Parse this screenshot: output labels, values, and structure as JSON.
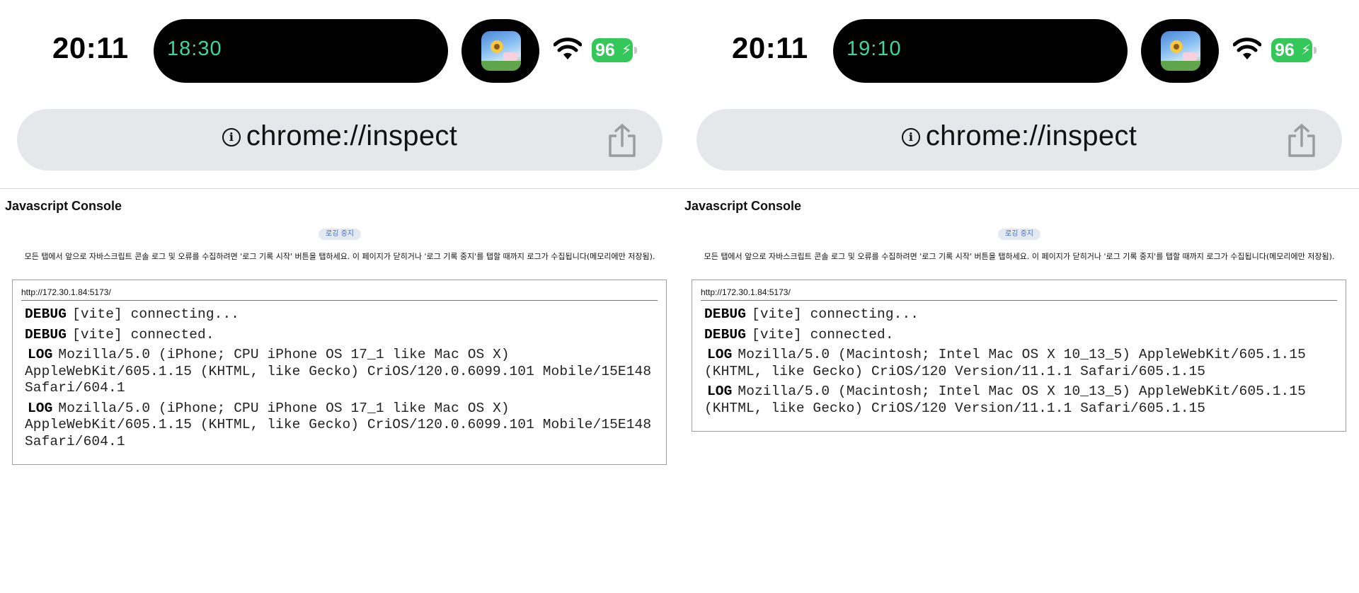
{
  "screens": [
    {
      "status_bar": {
        "time": "20:11",
        "island_timer": "18:30",
        "battery": "96",
        "battery_color": "#34c759",
        "timer_color": "#3fd69a"
      },
      "url_bar": {
        "url": "chrome://inspect",
        "info_icon": "info-icon",
        "share_icon": "share-icon"
      },
      "console": {
        "title": "Javascript Console",
        "stop_button": "로깅 중지",
        "description": "모든 탭에서 앞으로 자바스크립트 콘솔 로그 및 오류를 수집하려면 '로그 기록 시작' 버튼을 탭하세요. 이 페이지가 닫히거나 '로그 기록 중지'를 탭할 때까지 로그가 수집됩니다(메모리에만 저장됨).",
        "source_url": "http://172.30.1.84:5173/",
        "entries": [
          {
            "level": "DEBUG",
            "message": "[vite] connecting..."
          },
          {
            "level": "DEBUG",
            "message": "[vite] connected."
          },
          {
            "level": "LOG",
            "message": "Mozilla/5.0 (iPhone; CPU iPhone OS 17_1 like Mac OS X) AppleWebKit/605.1.15 (KHTML, like Gecko) CriOS/120.0.6099.101 Mobile/15E148 Safari/604.1"
          },
          {
            "level": "LOG",
            "message": "Mozilla/5.0 (iPhone; CPU iPhone OS 17_1 like Mac OS X) AppleWebKit/605.1.15 (KHTML, like Gecko) CriOS/120.0.6099.101 Mobile/15E148 Safari/604.1"
          }
        ]
      }
    },
    {
      "status_bar": {
        "time": "20:11",
        "island_timer": "19:10",
        "battery": "96",
        "battery_color": "#34c759",
        "timer_color": "#3fd69a"
      },
      "url_bar": {
        "url": "chrome://inspect",
        "info_icon": "info-icon",
        "share_icon": "share-icon"
      },
      "console": {
        "title": "Javascript Console",
        "stop_button": "로깅 중지",
        "description": "모든 탭에서 앞으로 자바스크립트 콘솔 로그 및 오류를 수집하려면 '로그 기록 시작' 버튼을 탭하세요. 이 페이지가 닫히거나 '로그 기록 중지'를 탭할 때까지 로그가 수집됩니다(메모리에만 저장됨).",
        "source_url": "http://172.30.1.84:5173/",
        "entries": [
          {
            "level": "DEBUG",
            "message": "[vite] connecting..."
          },
          {
            "level": "DEBUG",
            "message": "[vite] connected."
          },
          {
            "level": "LOG",
            "message": "Mozilla/5.0 (Macintosh; Intel Mac OS X 10_13_5) AppleWebKit/605.1.15 (KHTML, like Gecko) CriOS/120 Version/11.1.1 Safari/605.1.15"
          },
          {
            "level": "LOG",
            "message": "Mozilla/5.0 (Macintosh; Intel Mac OS X 10_13_5) AppleWebKit/605.1.15 (KHTML, like Gecko) CriOS/120 Version/11.1.1 Safari/605.1.15"
          }
        ]
      }
    }
  ]
}
